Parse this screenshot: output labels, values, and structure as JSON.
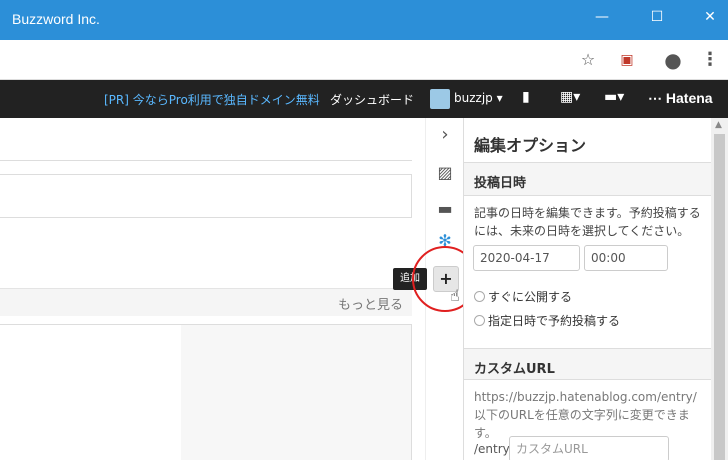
{
  "window": {
    "title": "Buzzword Inc.",
    "minimize": "—",
    "maximize": "☐",
    "close": "✕"
  },
  "toolbar": {
    "star_icon": "☆",
    "ext_icon": "▣",
    "profile_icon": "●",
    "menu_icon": "⋮"
  },
  "hatena_bar": {
    "promo": "[PR] 今ならPro利用で独自ドメイン無料",
    "dashboard": "ダッシュボード",
    "username": "buzzjp",
    "brand": "Hatena"
  },
  "main": {
    "more_link": "もっと見る"
  },
  "icon_column": {
    "tooltip": "追加",
    "add_label": "+"
  },
  "panel": {
    "title": "編集オプション",
    "post_date": {
      "heading": "投稿日時",
      "description": "記事の日時を編集できます。予約投稿するには、未来の日時を選択してください。",
      "date_value": "2020-04-17",
      "time_value": "00:00",
      "option_now": "すぐに公開する",
      "option_schedule": "指定日時で予約投稿する"
    },
    "custom_url": {
      "heading": "カスタムURL",
      "description": "https://buzzjp.hatenablog.com/entry/以下のURLを任意の文字列に変更できます。",
      "prefix": "/entry/",
      "placeholder": "カスタムURL"
    }
  }
}
